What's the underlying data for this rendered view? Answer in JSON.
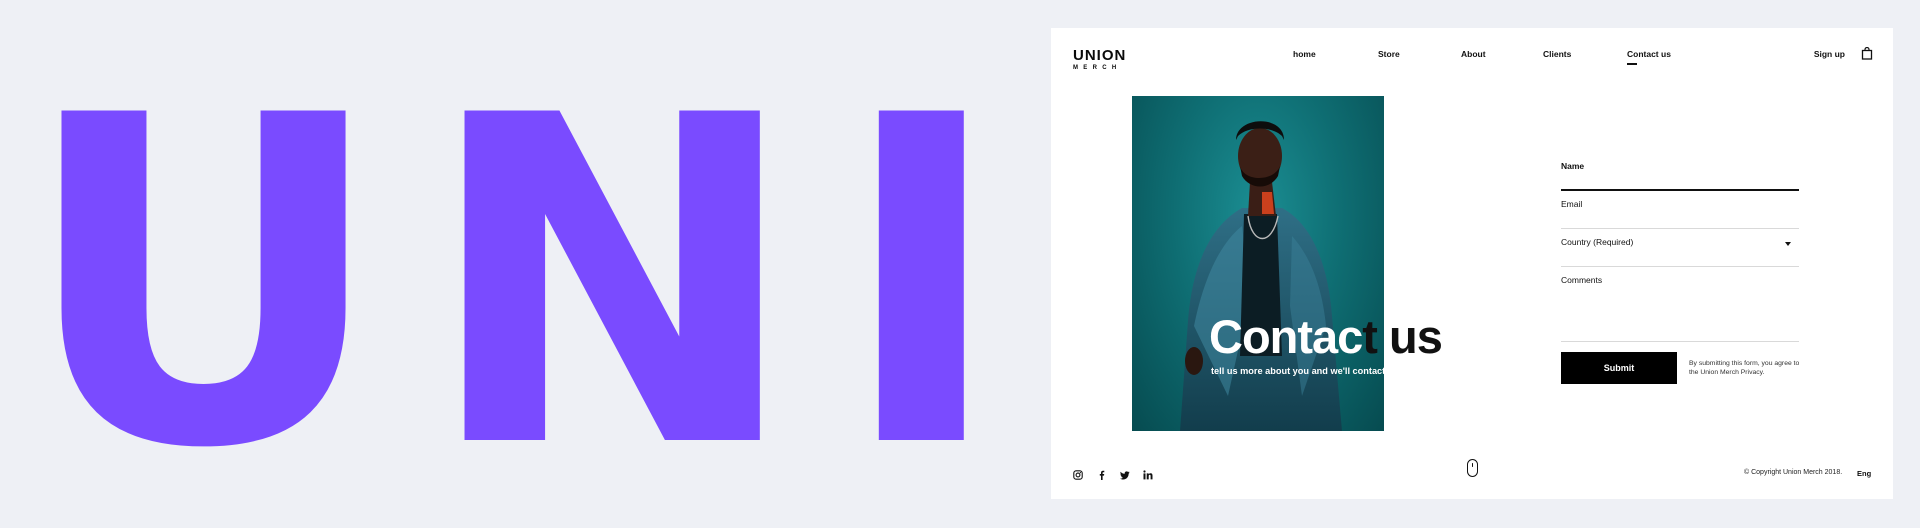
{
  "background": {
    "word": "UNIO",
    "color": "#7a4bff"
  },
  "header": {
    "logo_main": "UNION",
    "logo_sub": "MERCH",
    "nav": [
      {
        "label": "home"
      },
      {
        "label": "Store"
      },
      {
        "label": "About"
      },
      {
        "label": "Clients"
      },
      {
        "label": "Contact us",
        "active": true
      }
    ],
    "signup_label": "Sign up",
    "cart_icon": "shopping-bag-icon"
  },
  "hero": {
    "title_white": "Contac",
    "title_dark": "t us",
    "subtitle": "tell us more about you and we'll contact you soon",
    "photo_bg": "#0f6f74"
  },
  "form": {
    "name_label": "Name",
    "email_label": "Email",
    "country_label": "Country (Required)",
    "comments_label": "Comments",
    "submit_label": "Submit",
    "legal_text": "By submitting this form, you agree to the Union Merch Privacy."
  },
  "footer": {
    "social_icons": [
      "instagram-icon",
      "facebook-icon",
      "twitter-icon",
      "linkedin-icon"
    ],
    "scroll_icon": "mouse-scroll-icon",
    "copyright": "© Copyright Union Merch 2018.",
    "language": "Eng"
  }
}
